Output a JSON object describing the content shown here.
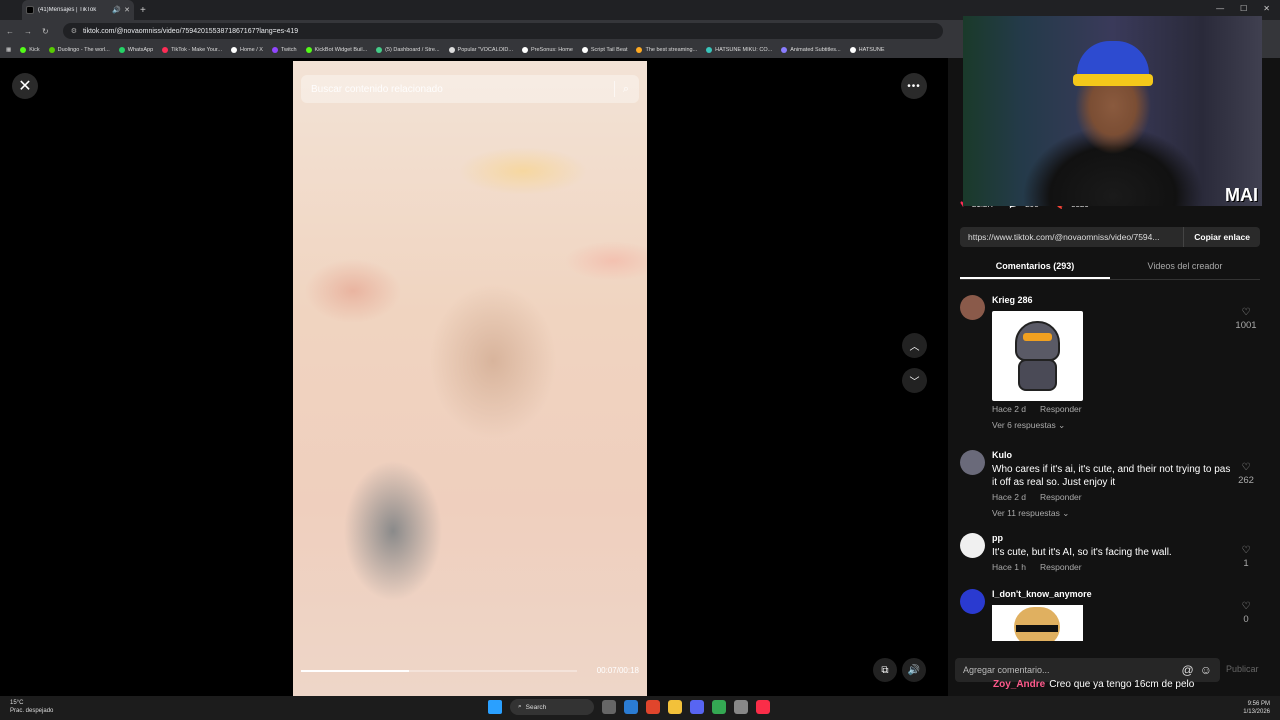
{
  "browser": {
    "tab_title": "(41)Mensajes | TikTok",
    "url": "tiktok.com/@novaomniss/video/7594201553871867167?lang=es-419",
    "bookmarks": [
      {
        "label": "Kick",
        "color": "#53fc18"
      },
      {
        "label": "Duolingo - The worl...",
        "color": "#58cc02"
      },
      {
        "label": "WhatsApp",
        "color": "#25d366"
      },
      {
        "label": "TikTok - Make Your...",
        "color": "#fe2c55"
      },
      {
        "label": "Home / X",
        "color": "#ffffff"
      },
      {
        "label": "Twitch",
        "color": "#9146ff"
      },
      {
        "label": "KickBot Widget Buil...",
        "color": "#53fc18"
      },
      {
        "label": "(5) Dashboard / Stre...",
        "color": "#44cc88"
      },
      {
        "label": "Popular \"VOCALOID...",
        "color": "#dddddd"
      },
      {
        "label": "PreSonus: Home",
        "color": "#ffffff"
      },
      {
        "label": "Script Tail Beat",
        "color": "#ffffff"
      },
      {
        "label": "The best streaming...",
        "color": "#ffaa22"
      },
      {
        "label": "HATSUNE MIKU: CO...",
        "color": "#39c5bb"
      },
      {
        "label": "Animated Subtitles...",
        "color": "#8a7dff"
      },
      {
        "label": "HATSUNE",
        "color": "#ffffff"
      }
    ]
  },
  "video": {
    "search_placeholder": "Buscar contenido relacionado",
    "time": "00:07/00:18",
    "progress_fraction": 0.39
  },
  "stats": {
    "likes": "21.2K",
    "comments": "293",
    "saves": "3329"
  },
  "share": {
    "url": "https://www.tiktok.com/@novaomniss/video/7594...",
    "copy_label": "Copiar enlace"
  },
  "panel_tabs": {
    "comments": "Comentarios (293)",
    "creator_videos": "Videos del creador"
  },
  "comments": [
    {
      "user": "Krieg 286",
      "text": "",
      "time": "Hace 2 d",
      "reply": "Responder",
      "more": "Ver 6 respuestas",
      "likes": "1001",
      "avatar_color": "#8a5a4a"
    },
    {
      "user": "Kulo",
      "text": "Who cares if it's ai, it's cute, and their not trying to pas it off as real so. Just enjoy it",
      "time": "Hace 2 d",
      "reply": "Responder",
      "more": "Ver 11 respuestas",
      "likes": "262",
      "avatar_color": "#6a6a7a"
    },
    {
      "user": "pp",
      "text": "It's cute, but it's AI, so it's facing the wall.",
      "time": "Hace 1 h",
      "reply": "Responder",
      "more": "",
      "likes": "1",
      "avatar_color": "#f0f0f0"
    },
    {
      "user": "I_don't_know_anymore",
      "text": "",
      "time": "",
      "reply": "",
      "more": "",
      "likes": "0",
      "avatar_color": "#2a3ad0"
    }
  ],
  "comment_input": {
    "placeholder": "Agregar comentario...",
    "publish": "Publicar"
  },
  "chat": {
    "user": "Zoy_Andre",
    "message": "Creo que ya tengo 16cm de pelo"
  },
  "webcam_logo": "MAI",
  "taskbar": {
    "temp": "15°C",
    "weather": "Prac. despejado",
    "search": "Search",
    "time": "9:56 PM",
    "date": "1/13/2026"
  }
}
